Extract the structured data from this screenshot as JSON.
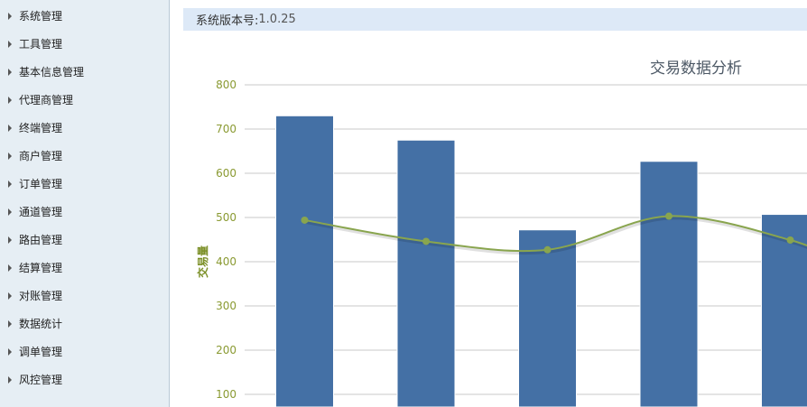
{
  "sidebar": {
    "items": [
      {
        "label": "系统管理"
      },
      {
        "label": "工具管理"
      },
      {
        "label": "基本信息管理"
      },
      {
        "label": "代理商管理"
      },
      {
        "label": "终端管理"
      },
      {
        "label": "商户管理"
      },
      {
        "label": "订单管理"
      },
      {
        "label": "通道管理"
      },
      {
        "label": "路由管理"
      },
      {
        "label": "结算管理"
      },
      {
        "label": "对账管理"
      },
      {
        "label": "数据统计"
      },
      {
        "label": "调单管理"
      },
      {
        "label": "风控管理"
      }
    ]
  },
  "version": {
    "label": "系统版本号:",
    "value": "1.0.25"
  },
  "chart_data": {
    "type": "bar",
    "title": "交易数据分析",
    "ylabel": "交易量",
    "ylim": [
      100,
      800
    ],
    "yticks": [
      100,
      200,
      300,
      400,
      500,
      600,
      700,
      800
    ],
    "grid": true,
    "series": [
      {
        "type": "bar",
        "values": [
          730,
          675,
          472,
          627,
          507
        ],
        "color": "#4470a5"
      },
      {
        "type": "spline",
        "values": [
          494,
          446,
          427,
          503,
          449
        ],
        "color": "#89a54e"
      }
    ]
  }
}
